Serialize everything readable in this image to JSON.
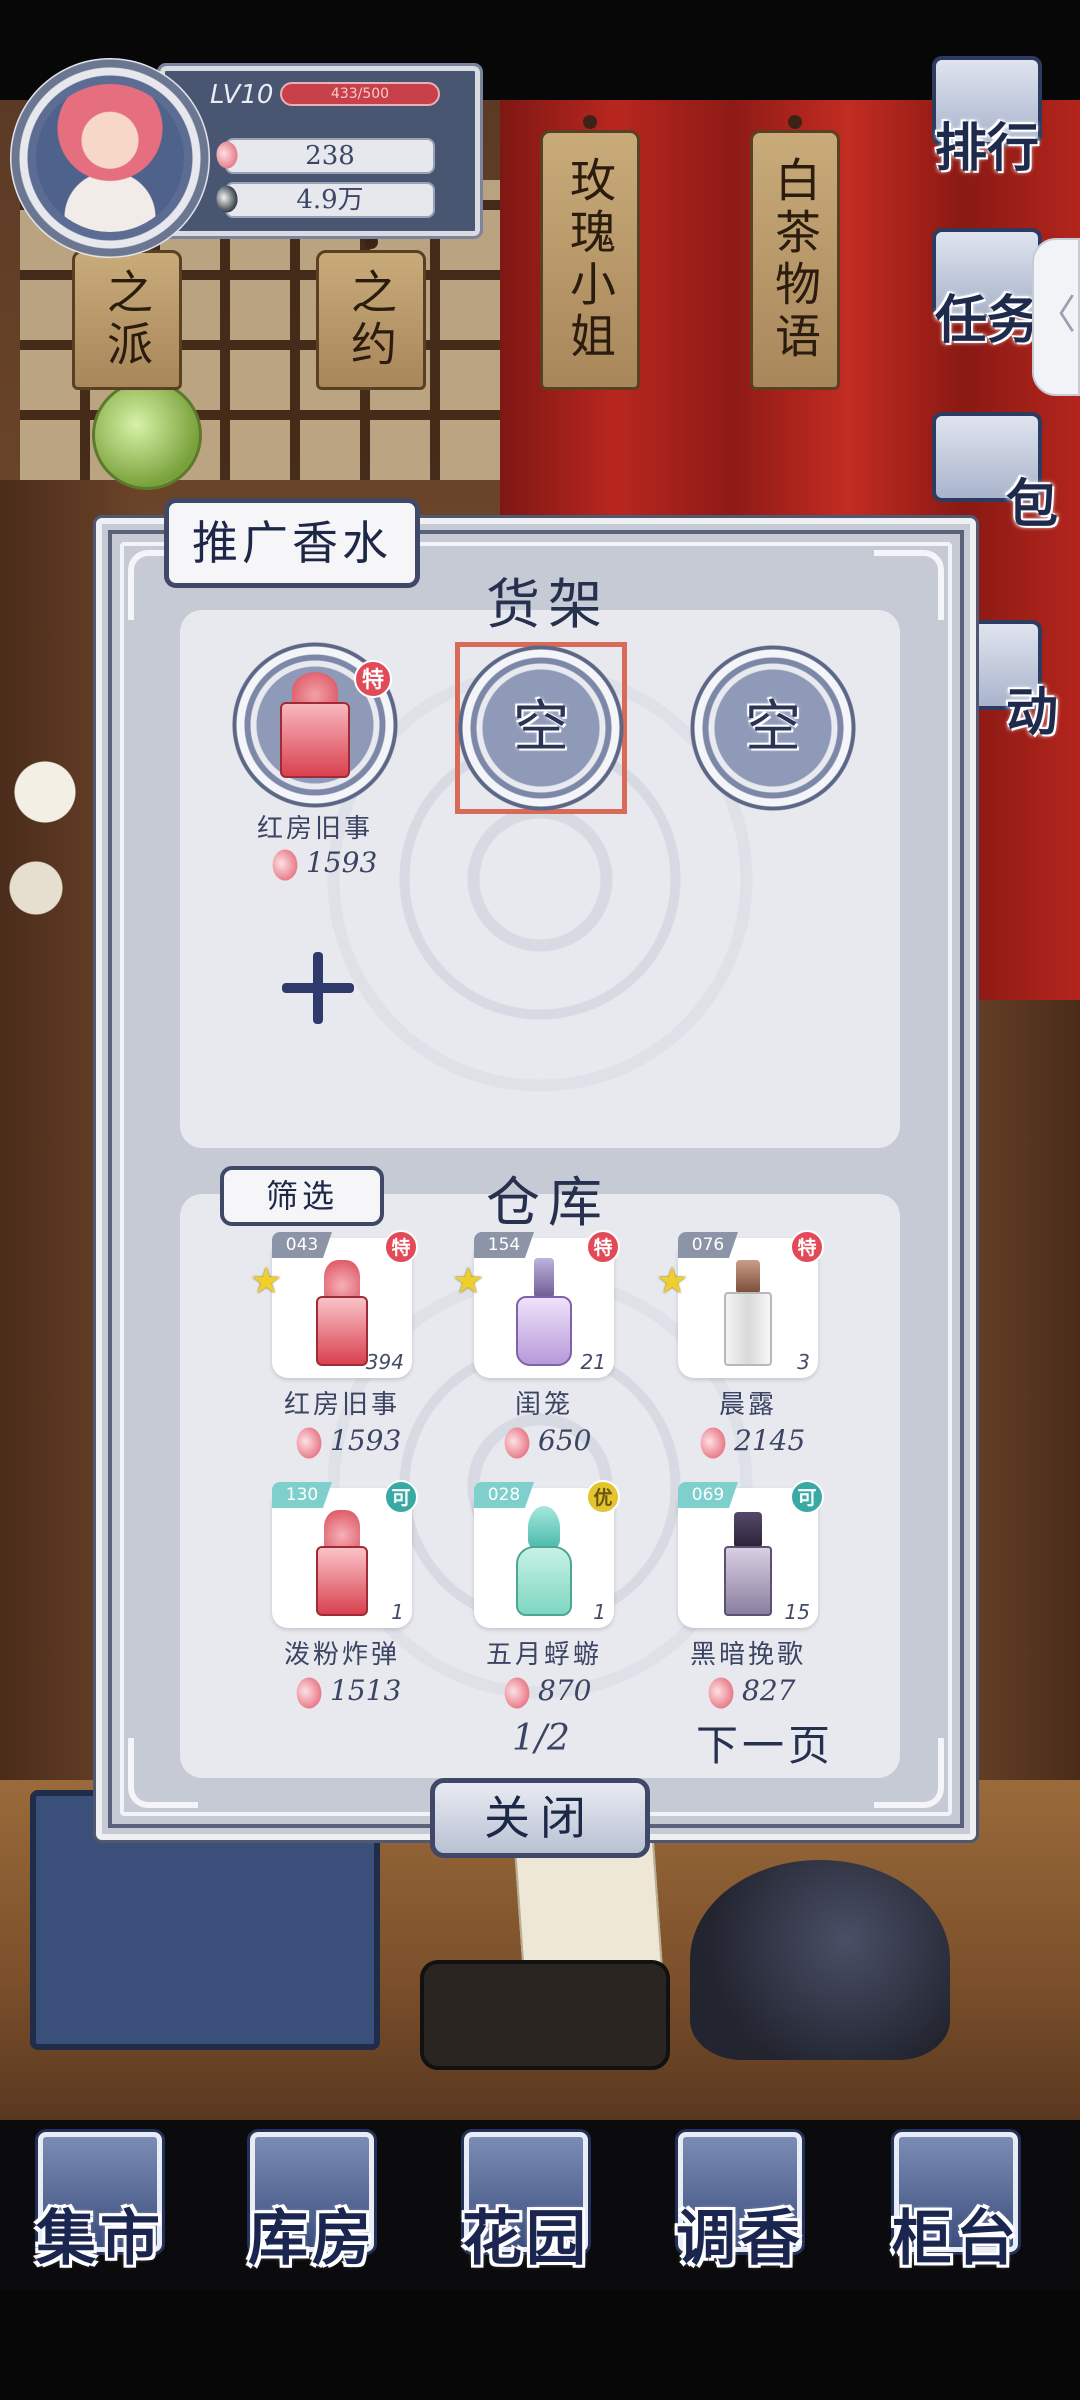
{
  "player": {
    "level": "LV10",
    "exp_text": "433/500",
    "petals": "238",
    "leaves": "4.9万"
  },
  "scene": {
    "tags": [
      "之派",
      "之约",
      "玫瑰小姐",
      "白茶物语"
    ]
  },
  "side_menu": {
    "items": [
      "排行",
      "任务",
      "包",
      "动"
    ],
    "collapse_glyph": "〈"
  },
  "dialog": {
    "title": "推广香水",
    "shelf": {
      "title": "货架",
      "slots": [
        {
          "filled": true,
          "name": "红房旧事",
          "price": "1593",
          "badge": "特"
        },
        {
          "filled": false,
          "label": "空"
        },
        {
          "filled": false,
          "label": "空"
        }
      ]
    },
    "warehouse": {
      "title": "仓库",
      "filter_label": "筛选",
      "items": [
        {
          "id": "043",
          "badge": "特",
          "starred": true,
          "qty": "394",
          "name": "红房旧事",
          "price": "1593"
        },
        {
          "id": "154",
          "badge": "特",
          "starred": true,
          "qty": "21",
          "name": "闺笼",
          "price": "650"
        },
        {
          "id": "076",
          "badge": "特",
          "starred": true,
          "qty": "3",
          "name": "晨露",
          "price": "2145"
        },
        {
          "id": "130",
          "badge": "可",
          "starred": false,
          "qty": "1",
          "name": "泼粉炸弹",
          "price": "1513"
        },
        {
          "id": "028",
          "badge": "优",
          "starred": false,
          "qty": "1",
          "name": "五月蜉蝣",
          "price": "870"
        },
        {
          "id": "069",
          "badge": "可",
          "starred": false,
          "qty": "15",
          "name": "黑暗挽歌",
          "price": "827"
        }
      ],
      "page": "1/2",
      "next_label": "下一页"
    },
    "close_label": "关闭"
  },
  "bottom_nav": {
    "items": [
      "集市",
      "库房",
      "花园",
      "调香",
      "柜台"
    ]
  },
  "colors": {
    "accent_navy": "#26304f",
    "badge_red": "#e24a57",
    "badge_teal": "#39a9a4",
    "badge_gold": "#e3c52f",
    "highlight": "#d96a58"
  }
}
